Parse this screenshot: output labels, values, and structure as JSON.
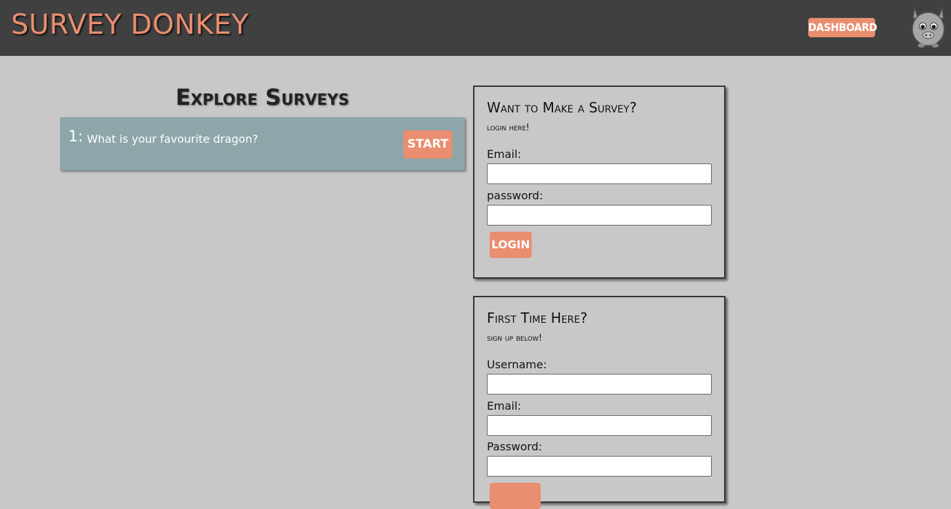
{
  "header": {
    "brand": "SURVEY DONKEY",
    "dashboard_label": "DASHBOARD",
    "logo_icon": "donkey-face-icon"
  },
  "explore": {
    "title": "Explore Surveys",
    "surveys": [
      {
        "number": "1:",
        "question": "What is your favourite dragon?",
        "start_label": "START"
      }
    ]
  },
  "login": {
    "title": "Want to Make a Survey?",
    "subtitle": "login here!",
    "email_label": "Email:",
    "email_value": "",
    "password_label": "password:",
    "password_value": "",
    "button_label": "LOGIN"
  },
  "signup": {
    "title": "First Time Here?",
    "subtitle": "sign up below!",
    "username_label": "Username:",
    "username_value": "",
    "email_label": "Email:",
    "email_value": "",
    "password_label": "Password:",
    "password_value": ""
  },
  "colors": {
    "header_bg": "#404040",
    "accent": "#e98e6f",
    "page_bg": "#c8c8c8",
    "card_bg": "#8ea6aa"
  }
}
